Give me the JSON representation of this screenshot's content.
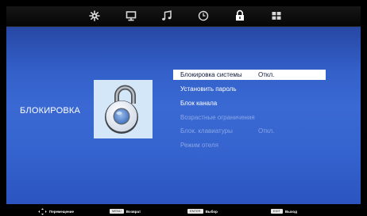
{
  "tabs": [
    {
      "name": "settings-gear-icon"
    },
    {
      "name": "monitor-icon"
    },
    {
      "name": "music-note-icon"
    },
    {
      "name": "clock-icon"
    },
    {
      "name": "lock-icon",
      "active": true
    },
    {
      "name": "grid-icon"
    }
  ],
  "section": {
    "title": "БЛОКИРОВКА",
    "icon": "padlock-icon"
  },
  "menu": {
    "items": [
      {
        "label": "Блокировка системы",
        "value": "Откл.",
        "state": "selected"
      },
      {
        "label": "Установить пароль",
        "value": "",
        "state": "normal"
      },
      {
        "label": "Блок канала",
        "value": "",
        "state": "normal"
      },
      {
        "label": "Возрастные ограничения",
        "value": "",
        "state": "disabled"
      },
      {
        "label": "Блок. клавиатуры",
        "value": "Откл.",
        "state": "disabled"
      },
      {
        "label": "Режим отеля",
        "value": "",
        "state": "disabled"
      }
    ]
  },
  "hints": {
    "navigate": {
      "icon": "dpad-icon",
      "label": "Перемещение"
    },
    "back": {
      "key": "MENU",
      "label": "Возврат"
    },
    "select": {
      "key": "ENTER",
      "label": "Выбор"
    },
    "exit": {
      "key": "EXIT",
      "label": "Выход"
    }
  },
  "colors": {
    "panel": "#3564cf",
    "selected_bg": "#ffffff",
    "text": "#ffffff",
    "disabled_text": "#89a6e6",
    "background": "#000000"
  }
}
